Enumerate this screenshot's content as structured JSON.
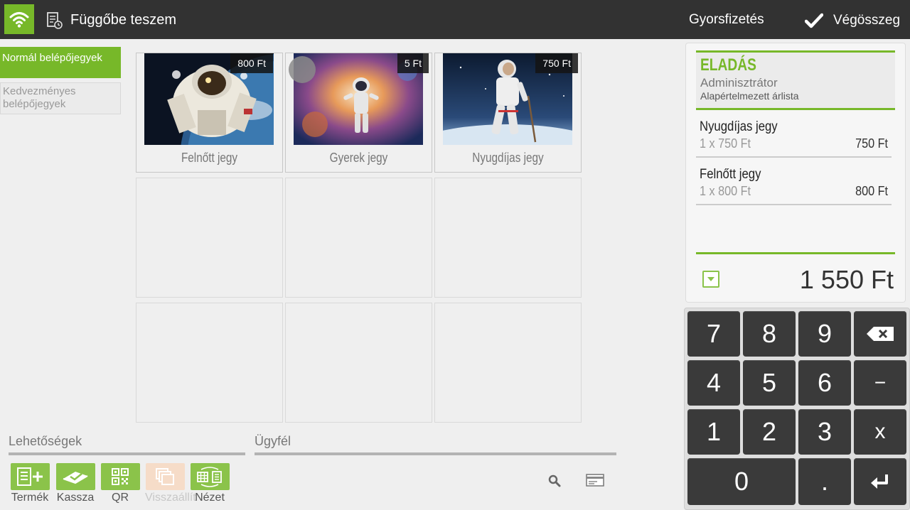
{
  "topbar": {
    "hold_label": "Függőbe teszem",
    "quickpay_label": "Gyorsfizetés",
    "total_label": "Végösszeg"
  },
  "categories": [
    {
      "label": "Normál belépőjegyek",
      "active": true
    },
    {
      "label": "Kedvezményes belépőjegyek",
      "active": false
    }
  ],
  "products": [
    {
      "name": "Felnőtt jegy",
      "price": "800 Ft"
    },
    {
      "name": "Gyerek jegy",
      "price": "5 Ft"
    },
    {
      "name": "Nyugdíjas jegy",
      "price": "750 Ft"
    }
  ],
  "options": {
    "title": "Lehetőségek",
    "tools": [
      {
        "label": "Termék",
        "icon": "product-add-icon",
        "enabled": true
      },
      {
        "label": "Kassza",
        "icon": "cash-register-icon",
        "enabled": true
      },
      {
        "label": "QR",
        "icon": "qr-code-icon",
        "enabled": true
      },
      {
        "label": "Visszaállít",
        "icon": "restore-icon",
        "enabled": false
      },
      {
        "label": "Nézet",
        "icon": "view-switch-icon",
        "enabled": true
      }
    ]
  },
  "customer": {
    "title": "Ügyfél"
  },
  "receipt": {
    "title": "ELADÁS",
    "user": "Adminisztrátor",
    "price_list": "Alapértelmezett árlista",
    "items": [
      {
        "name": "Nyugdíjas jegy",
        "qty": "1 x  750 Ft",
        "total": "750 Ft"
      },
      {
        "name": "Felnőtt jegy",
        "qty": "1 x  800 Ft",
        "total": "800 Ft"
      }
    ],
    "total": "1 550 Ft"
  },
  "keypad": {
    "keys": [
      "7",
      "8",
      "9",
      "4",
      "5",
      "6",
      "−",
      "1",
      "2",
      "3",
      "x",
      "0",
      "."
    ]
  },
  "colors": {
    "accent": "#77b829",
    "topbar": "#323232",
    "key": "#3a3a3a"
  }
}
